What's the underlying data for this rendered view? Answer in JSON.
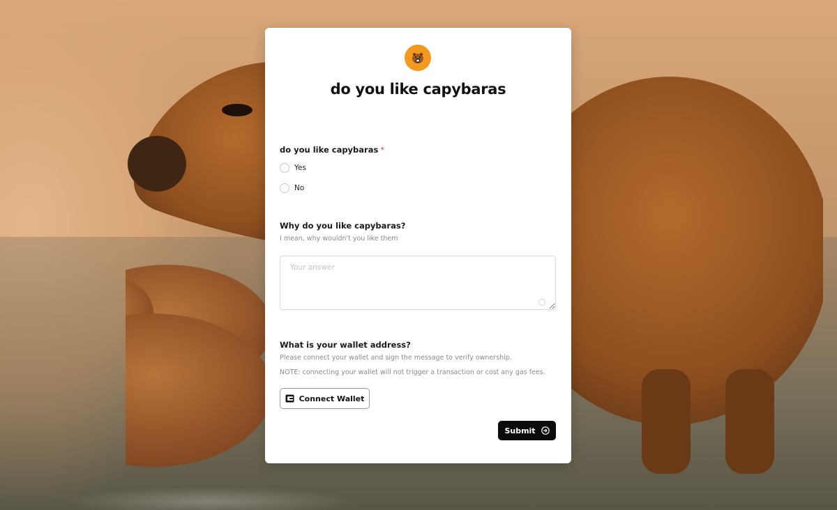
{
  "form": {
    "title": "do you like capybaras",
    "questions": [
      {
        "label": "do you like capybaras",
        "required_marker": "*",
        "options": [
          "Yes",
          "No"
        ]
      },
      {
        "label": "Why do you like capybaras?",
        "hint": "I mean, why wouldn't you like them",
        "placeholder": "Your answer"
      },
      {
        "label": "What is your wallet address?",
        "hint": "Please connect your wallet and sign the message to verify ownership.",
        "note": "NOTE: connecting your wallet will not trigger a transaction or cost any gas fees.",
        "button_label": "Connect Wallet"
      }
    ],
    "submit_label": "Submit"
  },
  "theme": {
    "logo_color": "#f29a1f",
    "submit_bg": "#0b0b0b",
    "required_color": "#e0463c"
  },
  "icons": {
    "logo": "capybara-logo-icon",
    "wallet": "wallet-icon",
    "submit": "arrow-right-circle-icon"
  }
}
